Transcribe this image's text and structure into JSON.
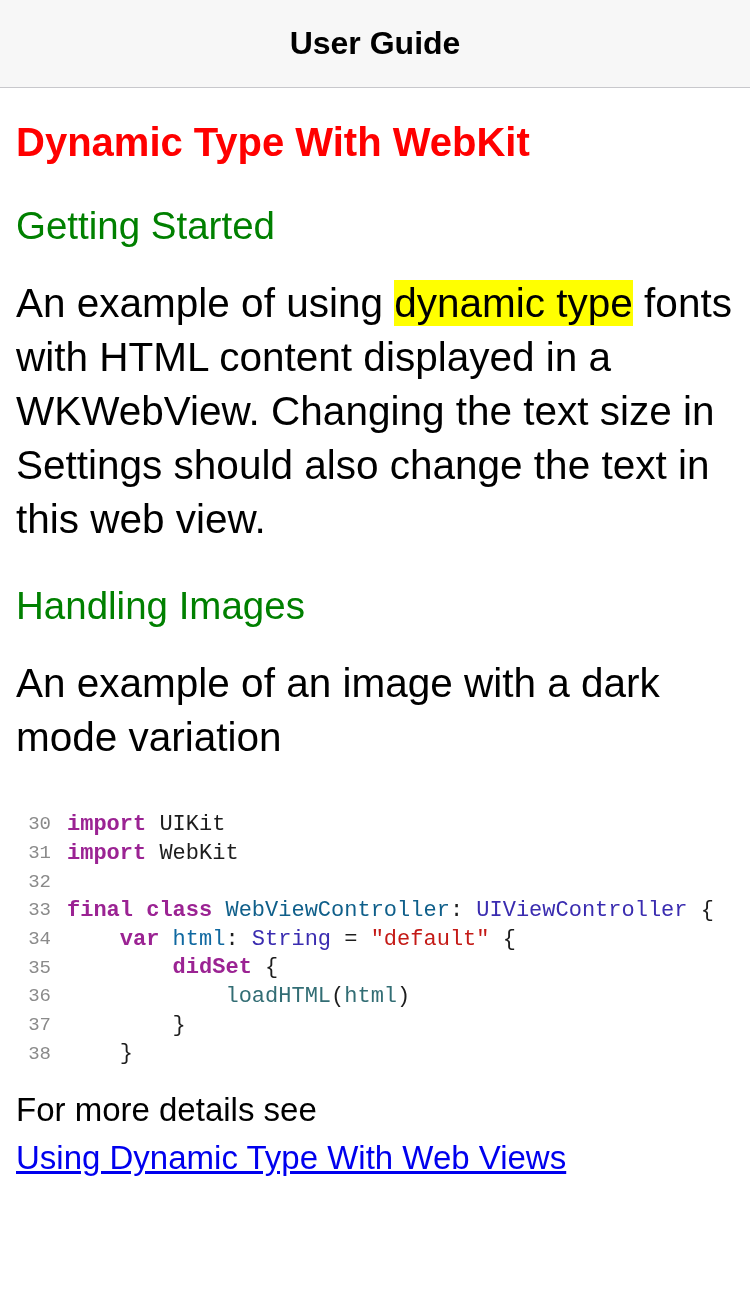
{
  "nav_bar": {
    "title": "User Guide"
  },
  "article": {
    "title": "Dynamic Type With WebKit",
    "sections": [
      {
        "heading": "Getting Started",
        "parts": [
          {
            "text": "An example of using ",
            "highlighted": false
          },
          {
            "text": "dynamic type",
            "highlighted": true
          },
          {
            "text": " fonts with HTML content displayed in a WKWebView. Changing the text size in Settings should also change the text in this web view.",
            "highlighted": false
          }
        ]
      },
      {
        "heading": "Handling Images",
        "parts": [
          {
            "text": "An example of an image with a dark mode variation",
            "highlighted": false
          }
        ]
      }
    ],
    "code_image": {
      "lines": [
        {
          "number": "30",
          "tokens": [
            {
              "text": "import",
              "kind": "keyword"
            },
            {
              "text": " UIKit",
              "kind": "plain"
            }
          ]
        },
        {
          "number": "31",
          "tokens": [
            {
              "text": "import",
              "kind": "keyword"
            },
            {
              "text": " WebKit",
              "kind": "plain"
            }
          ]
        },
        {
          "number": "32"
        },
        {
          "number": "33",
          "tokens": [
            {
              "text": "final class",
              "kind": "keyword"
            },
            {
              "text": " WebViewController",
              "kind": "declaration"
            },
            {
              "text": ": ",
              "kind": "plain"
            },
            {
              "text": "UIViewController",
              "kind": "type"
            },
            {
              "text": " {",
              "kind": "plain"
            }
          ]
        },
        {
          "number": "34",
          "tokens": [
            {
              "text": "    var",
              "kind": "keyword"
            },
            {
              "text": " html",
              "kind": "property"
            },
            {
              "text": ": ",
              "kind": "plain"
            },
            {
              "text": "String",
              "kind": "type"
            },
            {
              "text": " = ",
              "kind": "plain"
            },
            {
              "text": "\"default\"",
              "kind": "string"
            },
            {
              "text": " {",
              "kind": "plain"
            }
          ]
        },
        {
          "number": "35",
          "tokens": [
            {
              "text": "        didSet",
              "kind": "keyword"
            },
            {
              "text": " {",
              "kind": "plain"
            }
          ]
        },
        {
          "number": "36",
          "tokens": [
            {
              "text": "            loadHTML",
              "kind": "call"
            },
            {
              "text": "(",
              "kind": "plain"
            },
            {
              "text": "html",
              "kind": "call"
            },
            {
              "text": ")",
              "kind": "plain"
            }
          ]
        },
        {
          "number": "37",
          "tokens": [
            {
              "text": "        }",
              "kind": "plain"
            }
          ]
        },
        {
          "number": "38",
          "tokens": [
            {
              "text": "    }",
              "kind": "plain"
            }
          ]
        }
      ]
    },
    "footer": {
      "text": "For more details see ",
      "link": "Using Dynamic Type With Web Views"
    }
  }
}
